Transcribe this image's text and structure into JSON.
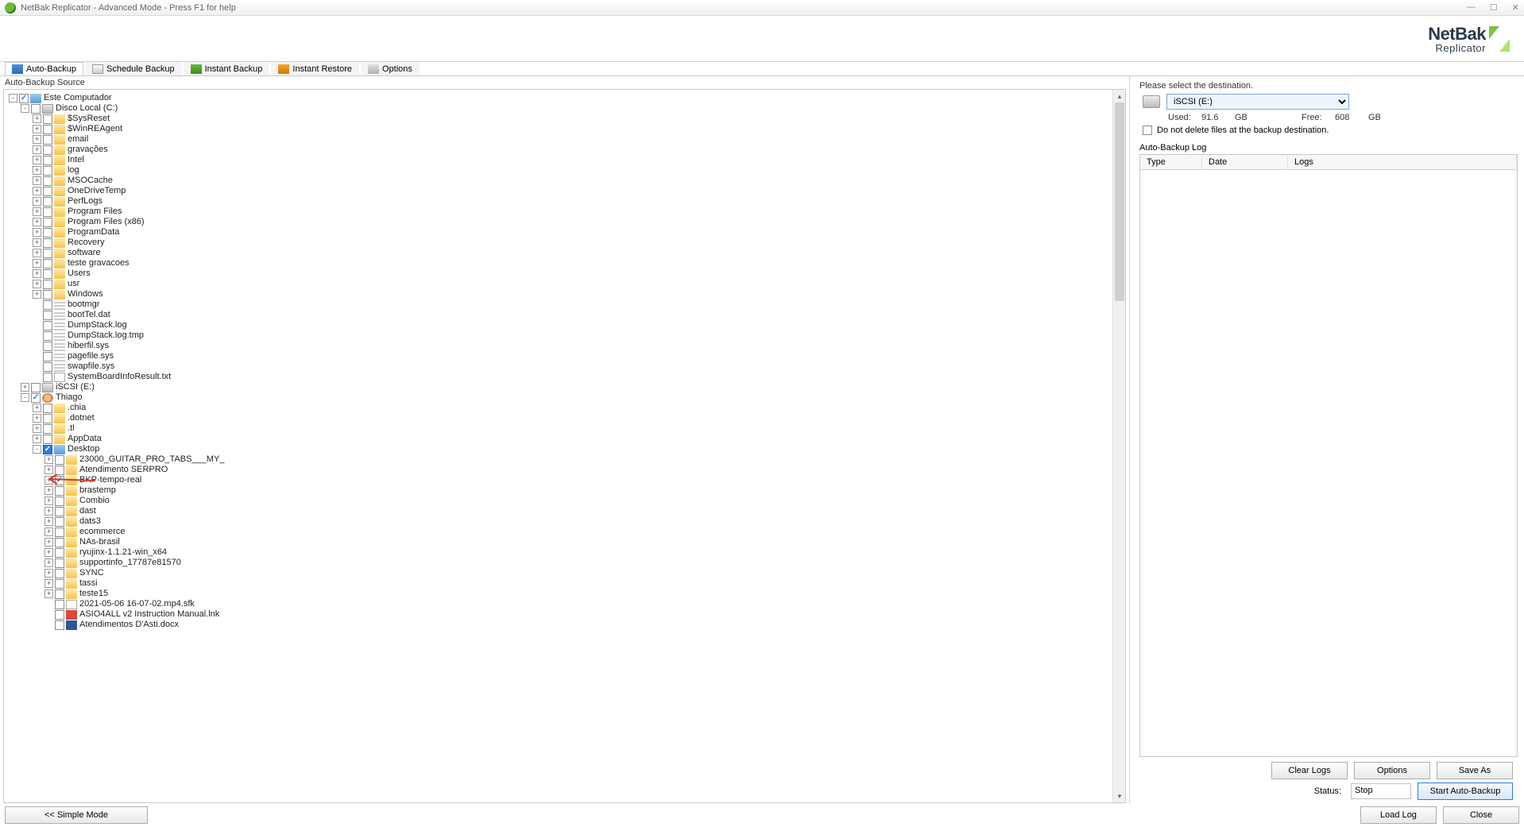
{
  "window": {
    "title": "NetBak Replicator - Advanced Mode - Press F1 for help"
  },
  "logo": {
    "line1": "NetBak",
    "line2": "Replicator"
  },
  "toolbar": [
    {
      "id": "auto-backup",
      "label": "Auto-Backup"
    },
    {
      "id": "schedule-backup",
      "label": "Schedule Backup"
    },
    {
      "id": "instant-backup",
      "label": "Instant Backup"
    },
    {
      "id": "instant-restore",
      "label": "Instant Restore"
    },
    {
      "id": "options",
      "label": "Options"
    }
  ],
  "source_header": "Auto-Backup Source",
  "tree": {
    "root": [
      {
        "pad": 0,
        "exp": "-",
        "cb": "checked",
        "icon": "comp",
        "label": "Este Computador"
      },
      {
        "pad": 1,
        "exp": "-",
        "cb": "",
        "icon": "drive",
        "label": "Disco Local (C:)"
      },
      {
        "pad": 2,
        "exp": "+",
        "cb": "",
        "icon": "folder",
        "label": "$SysReset"
      },
      {
        "pad": 2,
        "exp": "+",
        "cb": "",
        "icon": "folder",
        "label": "$WinREAgent"
      },
      {
        "pad": 2,
        "exp": "+",
        "cb": "",
        "icon": "folder",
        "label": "email"
      },
      {
        "pad": 2,
        "exp": "+",
        "cb": "",
        "icon": "folder",
        "label": "gravações"
      },
      {
        "pad": 2,
        "exp": "+",
        "cb": "",
        "icon": "folder",
        "label": "Intel"
      },
      {
        "pad": 2,
        "exp": "+",
        "cb": "",
        "icon": "folder",
        "label": "log"
      },
      {
        "pad": 2,
        "exp": "+",
        "cb": "",
        "icon": "folder",
        "label": "MSOCache"
      },
      {
        "pad": 2,
        "exp": "+",
        "cb": "",
        "icon": "folder",
        "label": "OneDriveTemp"
      },
      {
        "pad": 2,
        "exp": "+",
        "cb": "",
        "icon": "folder",
        "label": "PerfLogs"
      },
      {
        "pad": 2,
        "exp": "+",
        "cb": "",
        "icon": "folder",
        "label": "Program Files"
      },
      {
        "pad": 2,
        "exp": "+",
        "cb": "",
        "icon": "folder",
        "label": "Program Files (x86)"
      },
      {
        "pad": 2,
        "exp": "+",
        "cb": "",
        "icon": "folder",
        "label": "ProgramData"
      },
      {
        "pad": 2,
        "exp": "+",
        "cb": "",
        "icon": "folder",
        "label": "Recovery"
      },
      {
        "pad": 2,
        "exp": "+",
        "cb": "",
        "icon": "folder",
        "label": "software"
      },
      {
        "pad": 2,
        "exp": "+",
        "cb": "",
        "icon": "folder",
        "label": "teste gravacoes"
      },
      {
        "pad": 2,
        "exp": "+",
        "cb": "",
        "icon": "folder",
        "label": "Users"
      },
      {
        "pad": 2,
        "exp": "+",
        "cb": "",
        "icon": "folder",
        "label": "usr"
      },
      {
        "pad": 2,
        "exp": "+",
        "cb": "",
        "icon": "folder",
        "label": "Windows"
      },
      {
        "pad": 2,
        "exp": "",
        "cb": "",
        "icon": "dash",
        "label": "bootmgr"
      },
      {
        "pad": 2,
        "exp": "",
        "cb": "",
        "icon": "dash",
        "label": "bootTel.dat"
      },
      {
        "pad": 2,
        "exp": "",
        "cb": "",
        "icon": "dash",
        "label": "DumpStack.log"
      },
      {
        "pad": 2,
        "exp": "",
        "cb": "",
        "icon": "dash",
        "label": "DumpStack.log.tmp"
      },
      {
        "pad": 2,
        "exp": "",
        "cb": "",
        "icon": "dash",
        "label": "hiberfil.sys"
      },
      {
        "pad": 2,
        "exp": "",
        "cb": "",
        "icon": "dash",
        "label": "pagefile.sys"
      },
      {
        "pad": 2,
        "exp": "",
        "cb": "",
        "icon": "dash",
        "label": "swapfile.sys"
      },
      {
        "pad": 2,
        "exp": "",
        "cb": "",
        "icon": "file",
        "label": "SystemBoardInfoResult.txt"
      },
      {
        "pad": 1,
        "exp": "+",
        "cb": "",
        "icon": "drive",
        "label": "iSCSI (E:)"
      },
      {
        "pad": 1,
        "exp": "-",
        "cb": "checked",
        "icon": "user",
        "label": "Thiago"
      },
      {
        "pad": 2,
        "exp": "+",
        "cb": "",
        "icon": "folder",
        "label": ".chia"
      },
      {
        "pad": 2,
        "exp": "+",
        "cb": "",
        "icon": "folder",
        "label": ".dotnet"
      },
      {
        "pad": 2,
        "exp": "+",
        "cb": "",
        "icon": "folder",
        "label": ".tl"
      },
      {
        "pad": 2,
        "exp": "+",
        "cb": "",
        "icon": "folder",
        "label": "AppData"
      },
      {
        "pad": 2,
        "exp": "-",
        "cb": "bluechecked",
        "icon": "folderblue",
        "label": "Desktop"
      },
      {
        "pad": 3,
        "exp": "+",
        "cb": "",
        "icon": "folder",
        "label": "23000_GUITAR_PRO_TABS___MY_"
      },
      {
        "pad": 3,
        "exp": "+",
        "cb": "",
        "icon": "folder",
        "label": "Atendimento SERPRO"
      },
      {
        "pad": 3,
        "exp": "+",
        "cb": "checked",
        "icon": "folder",
        "label": "BKP-tempo-real",
        "anno": true
      },
      {
        "pad": 3,
        "exp": "+",
        "cb": "",
        "icon": "folder",
        "label": "brastemp"
      },
      {
        "pad": 3,
        "exp": "+",
        "cb": "",
        "icon": "folder",
        "label": "Combio"
      },
      {
        "pad": 3,
        "exp": "+",
        "cb": "",
        "icon": "folder",
        "label": "dast"
      },
      {
        "pad": 3,
        "exp": "+",
        "cb": "",
        "icon": "folder",
        "label": "dats3"
      },
      {
        "pad": 3,
        "exp": "+",
        "cb": "",
        "icon": "folder",
        "label": "ecommerce"
      },
      {
        "pad": 3,
        "exp": "+",
        "cb": "",
        "icon": "folder",
        "label": "NAs-brasil"
      },
      {
        "pad": 3,
        "exp": "+",
        "cb": "",
        "icon": "folder",
        "label": "ryujinx-1.1.21-win_x64"
      },
      {
        "pad": 3,
        "exp": "+",
        "cb": "",
        "icon": "folder",
        "label": "supportinfo_17787e81570"
      },
      {
        "pad": 3,
        "exp": "+",
        "cb": "",
        "icon": "folder",
        "label": "SYNC"
      },
      {
        "pad": 3,
        "exp": "+",
        "cb": "",
        "icon": "folder",
        "label": "tassi"
      },
      {
        "pad": 3,
        "exp": "+",
        "cb": "",
        "icon": "folder",
        "label": "teste15"
      },
      {
        "pad": 3,
        "exp": "",
        "cb": "",
        "icon": "file",
        "label": "2021-05-06 16-07-02.mp4.sfk"
      },
      {
        "pad": 3,
        "exp": "",
        "cb": "",
        "icon": "pdf",
        "label": "ASIO4ALL v2 Instruction Manual.lnk"
      },
      {
        "pad": 3,
        "exp": "",
        "cb": "",
        "icon": "docx",
        "label": "Atendimentos D'Asti.docx"
      }
    ]
  },
  "dest": {
    "prompt": "Please select the destination.",
    "selected": "iSCSI (E:)",
    "used_label": "Used:",
    "used_value": "91.6",
    "used_unit": "GB",
    "free_label": "Free:",
    "free_value": "608",
    "free_unit": "GB",
    "no_delete_label": "Do not delete files at the backup destination.",
    "log_header": "Auto-Backup Log",
    "col_type": "Type",
    "col_date": "Date",
    "col_logs": "Logs"
  },
  "buttons": {
    "clear_logs": "Clear Logs",
    "options": "Options",
    "save_as": "Save As",
    "status_label": "Status:",
    "status_value": "Stop",
    "start": "Start Auto-Backup",
    "simple_mode": "<<  Simple Mode",
    "load_log": "Load Log",
    "close": "Close"
  }
}
